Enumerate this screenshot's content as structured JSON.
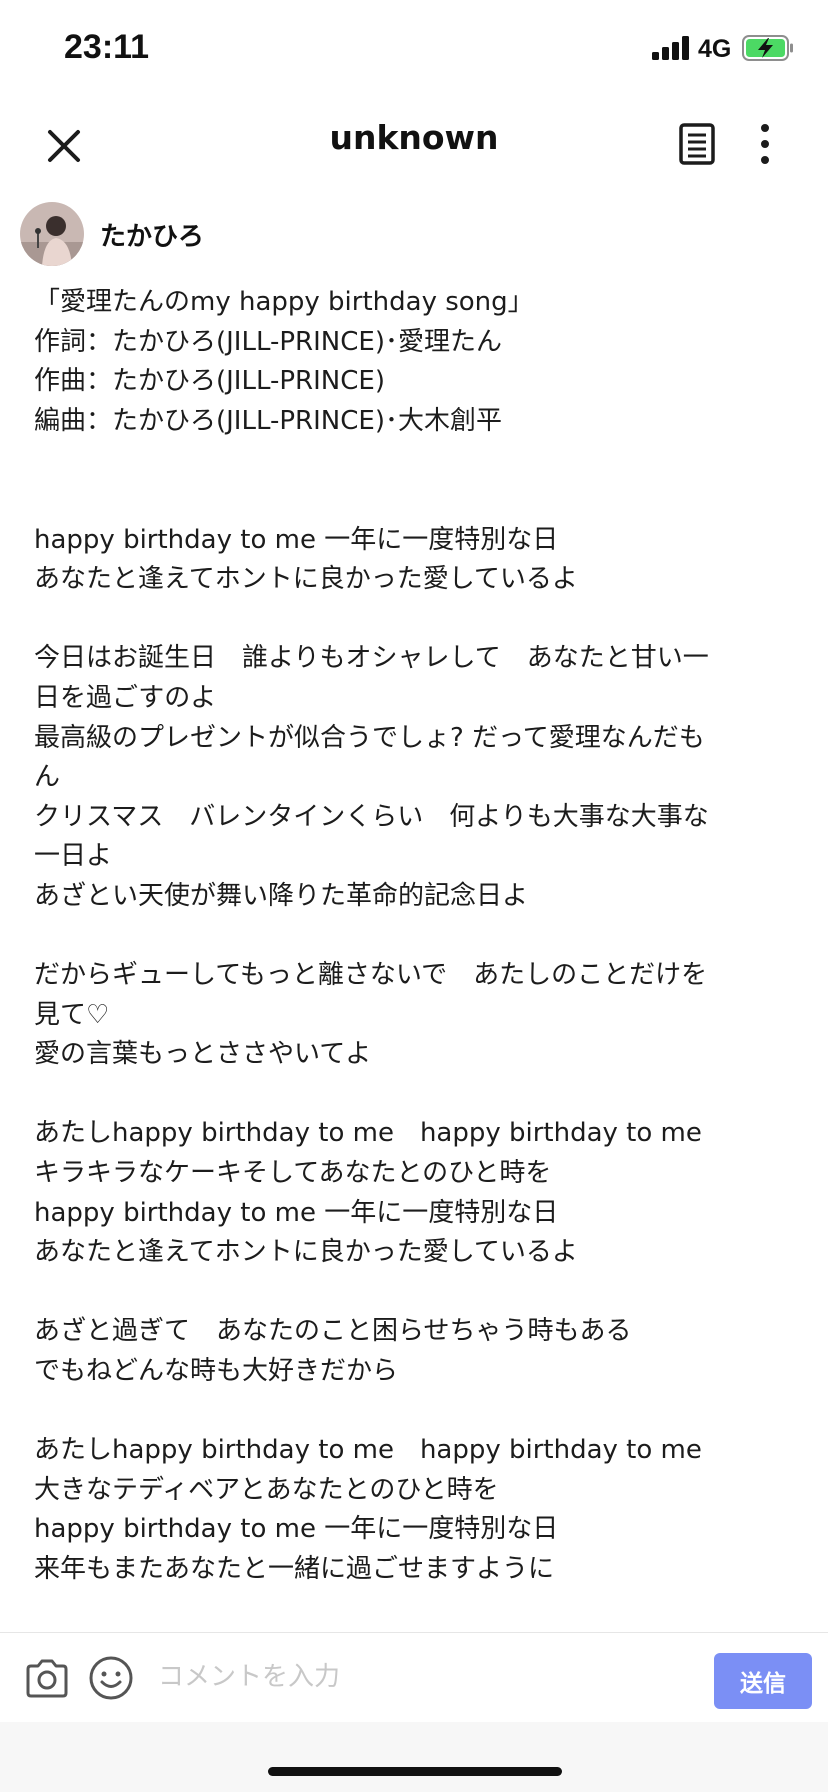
{
  "status_bar": {
    "time": "23:11",
    "network": "4G",
    "signal_icon": "signal-bars-icon",
    "battery_icon": "battery-charging-icon",
    "battery_color": "#4cd964"
  },
  "nav": {
    "title": "unknown",
    "close_icon": "close-icon",
    "doc_icon": "document-icon",
    "more_icon": "more-vertical-icon"
  },
  "post": {
    "author": "たかひろ",
    "lines": [
      "「愛理たんのmy happy birthday song」",
      "作詞：たかひろ(JILL-PRINCE)･愛理たん",
      "作曲：たかひろ(JILL-PRINCE)",
      "編曲：たかひろ(JILL-PRINCE)･大木創平",
      "",
      "",
      "happy birthday to me 一年に一度特別な日",
      "あなたと逢えてホントに良かった愛しているよ",
      "",
      "今日はお誕生日　誰よりもオシャレして　あなたと甘い一",
      "日を過ごすのよ",
      "最高級のプレゼントが似合うでしょ? だって愛理なんだも",
      "ん",
      "クリスマス　バレンタインくらい　何よりも大事な大事な",
      "一日よ",
      "あざとい天使が舞い降りた革命的記念日よ",
      "",
      "だからギューしてもっと離さないで　あたしのことだけを",
      "見て♡",
      "愛の言葉もっとささやいてよ",
      "",
      "あたしhappy birthday to me　happy birthday to me",
      "キラキラなケーキそしてあなたとのひと時を",
      "happy birthday to me 一年に一度特別な日",
      "あなたと逢えてホントに良かった愛しているよ",
      "",
      "あざと過ぎて　あなたのこと困らせちゃう時もある",
      "でもねどんな時も大好きだから",
      "",
      "あたしhappy birthday to me　happy birthday to me",
      "大きなテディベアとあなたとのひと時を",
      "happy birthday to me 一年に一度特別な日",
      "来年もまたあなたと一緒に過ごせますように"
    ]
  },
  "comment_bar": {
    "placeholder": "コメントを入力",
    "value": "",
    "send_label": "送信",
    "send_color": "#7b8ff5",
    "camera_icon": "camera-icon",
    "emoji_icon": "smiley-icon"
  }
}
